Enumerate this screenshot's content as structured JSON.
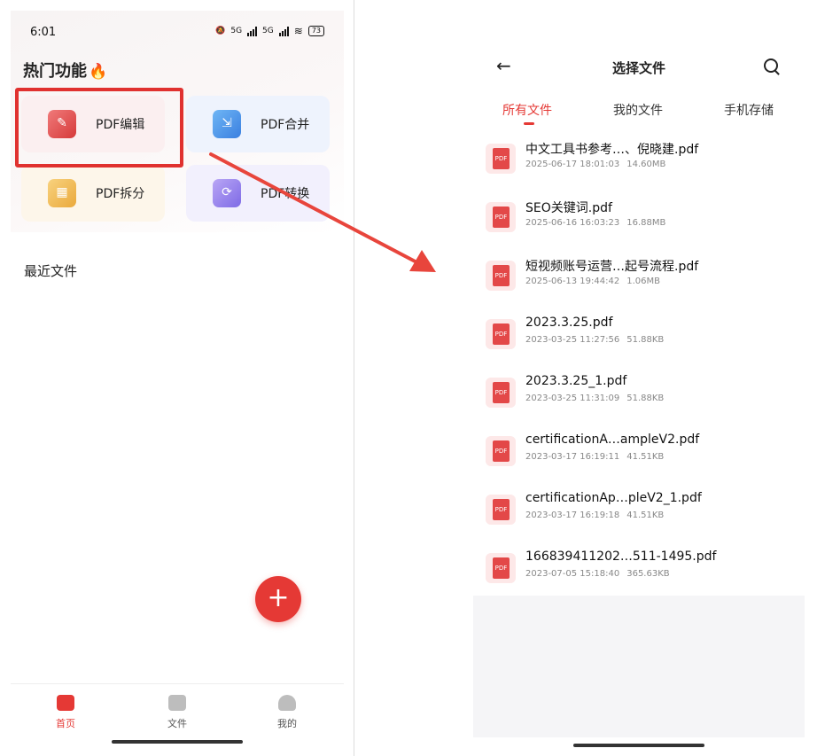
{
  "left_screen": {
    "status": {
      "time": "6:01",
      "net1": "5G",
      "net2": "5G",
      "battery": "73"
    },
    "section_title": "热门功能",
    "functions": [
      {
        "label": "PDF编辑",
        "icon": "pdf-edit-icon"
      },
      {
        "label": "PDF合并",
        "icon": "pdf-merge-icon"
      },
      {
        "label": "PDF拆分",
        "icon": "pdf-split-icon"
      },
      {
        "label": "PDF转换",
        "icon": "pdf-convert-icon"
      }
    ],
    "recent_title": "最近文件",
    "fab_label": "+",
    "nav": [
      {
        "label": "首页",
        "icon": "home-icon",
        "active": true
      },
      {
        "label": "文件",
        "icon": "folder-icon",
        "active": false
      },
      {
        "label": "我的",
        "icon": "user-icon",
        "active": false
      }
    ]
  },
  "right_screen": {
    "title": "选择文件",
    "tabs": [
      "所有文件",
      "我的文件",
      "手机存储"
    ],
    "active_tab": "所有文件",
    "file_icon_label": "PDF",
    "files": [
      {
        "name": "中文工具书参考…、倪晓建.pdf",
        "date": "2025-06-17 18:01:03",
        "size": "14.60MB"
      },
      {
        "name": "SEO关键词.pdf",
        "date": "2025-06-16 16:03:23",
        "size": "16.88MB"
      },
      {
        "name": "短视频账号运营…起号流程.pdf",
        "date": "2025-06-13 19:44:42",
        "size": "1.06MB"
      },
      {
        "name": "2023.3.25.pdf",
        "date": "2023-03-25 11:27:56",
        "size": "51.88KB"
      },
      {
        "name": "2023.3.25_1.pdf",
        "date": "2023-03-25 11:31:09",
        "size": "51.88KB"
      },
      {
        "name": "certificationA…ampleV2.pdf",
        "date": "2023-03-17 16:19:11",
        "size": "41.51KB"
      },
      {
        "name": "certificationAp…pleV2_1.pdf",
        "date": "2023-03-17 16:19:18",
        "size": "41.51KB"
      },
      {
        "name": "166839411202…511-1495.pdf",
        "date": "2023-07-05 15:18:40",
        "size": "365.63KB"
      }
    ]
  },
  "colors": {
    "accent": "#e53935",
    "highlight": "#e0312f",
    "arrow": "#e8453c"
  }
}
